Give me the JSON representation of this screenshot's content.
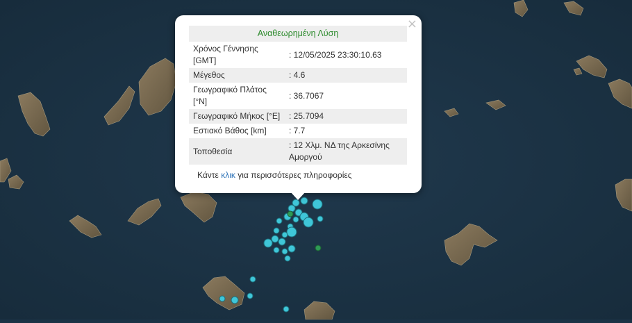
{
  "popup": {
    "title": "Αναθεωρημένη Λύση",
    "close_symbol": "×",
    "rows": [
      {
        "label": "Χρόνος Γέννησης [GMT]",
        "value": ": 12/05/2025 23:30:10.63"
      },
      {
        "label": "Μέγεθος",
        "value": ": 4.6"
      },
      {
        "label": "Γεωγραφικό Πλάτος [°N]",
        "value": ": 36.7067"
      },
      {
        "label": "Γεωγραφικό Μήκος [°E]",
        "value": ": 25.7094"
      },
      {
        "label": "Εστιακό Βάθος [km]",
        "value": ": 7.7"
      },
      {
        "label": "Τοποθεσία",
        "value": ": 12 Χλμ. ΝΔ της Αρκεσίνης Αμοργού"
      }
    ],
    "more_prefix": "Κάντε",
    "more_link": "κλικ",
    "more_suffix": "για περισσότερες πληροφορίες"
  },
  "map": {
    "base": "satellite-imagery",
    "colors": {
      "sea": "#1b3346",
      "land": "#7a6a52",
      "event_marker": "#3fc6d8",
      "highlight_marker": "#2e9a55"
    }
  }
}
